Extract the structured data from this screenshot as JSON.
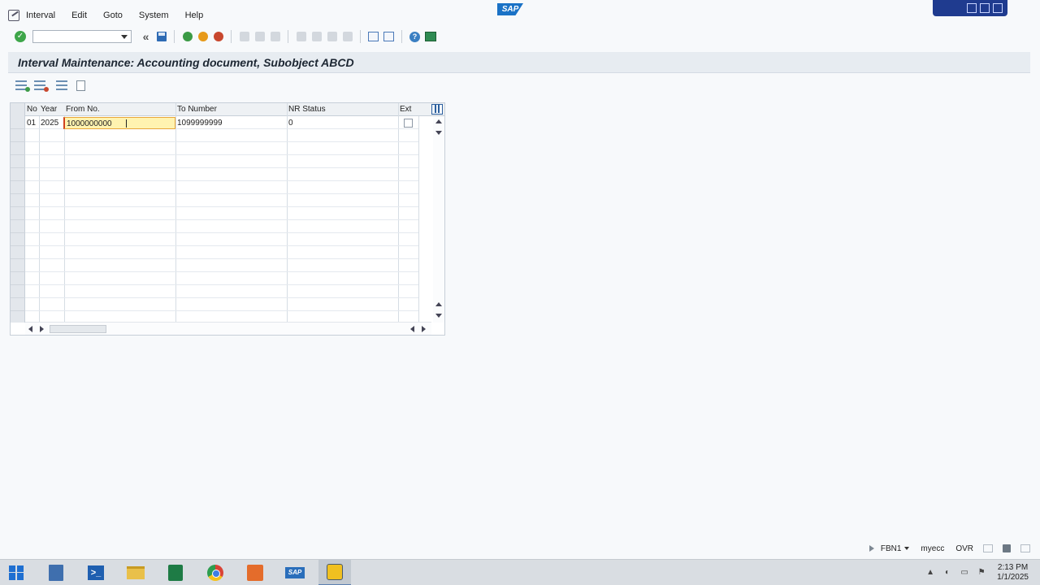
{
  "menu": {
    "items": [
      "Interval",
      "Edit",
      "Goto",
      "System",
      "Help"
    ]
  },
  "toolbar": {
    "command_field_value": "",
    "icons": [
      "enter-check-icon",
      "command-dropdown",
      "back-double-icon",
      "save-icon",
      "back-icon",
      "exit-icon",
      "cancel-icon",
      "print-icon",
      "find-icon",
      "find-next-icon",
      "first-page-icon",
      "prev-page-icon",
      "next-page-icon",
      "last-page-icon",
      "new-session-icon",
      "shortcut-icon",
      "help-icon",
      "customize-layout-icon"
    ]
  },
  "page": {
    "title": "Interval Maintenance: Accounting document, Subobject ABCD"
  },
  "table": {
    "columns": [
      "No",
      "Year",
      "From No.",
      "To Number",
      "NR Status",
      "Ext"
    ],
    "rows": [
      {
        "no": "01",
        "year": "2025",
        "from_no": "1000000000",
        "to_number": "1099999999",
        "nr_status": "0",
        "ext": false
      }
    ]
  },
  "statusbar": {
    "logo_text": "SAP",
    "transaction": "FBN1",
    "system": "myecc",
    "mode": "OVR"
  },
  "taskbar": {
    "apps": [
      "start",
      "server-manager",
      "powershell",
      "file-explorer",
      "excel",
      "chrome",
      "orange-app",
      "sap-gui",
      "sap-logon"
    ],
    "sap_text": "SAP",
    "ps_text": ">_",
    "clock_time": "2:13 PM",
    "clock_date": "1/1/2025"
  },
  "colors": {
    "accent": "#1f3b8f",
    "input_highlight": "#fff3b0",
    "sap_blue": "#1a72c6"
  }
}
